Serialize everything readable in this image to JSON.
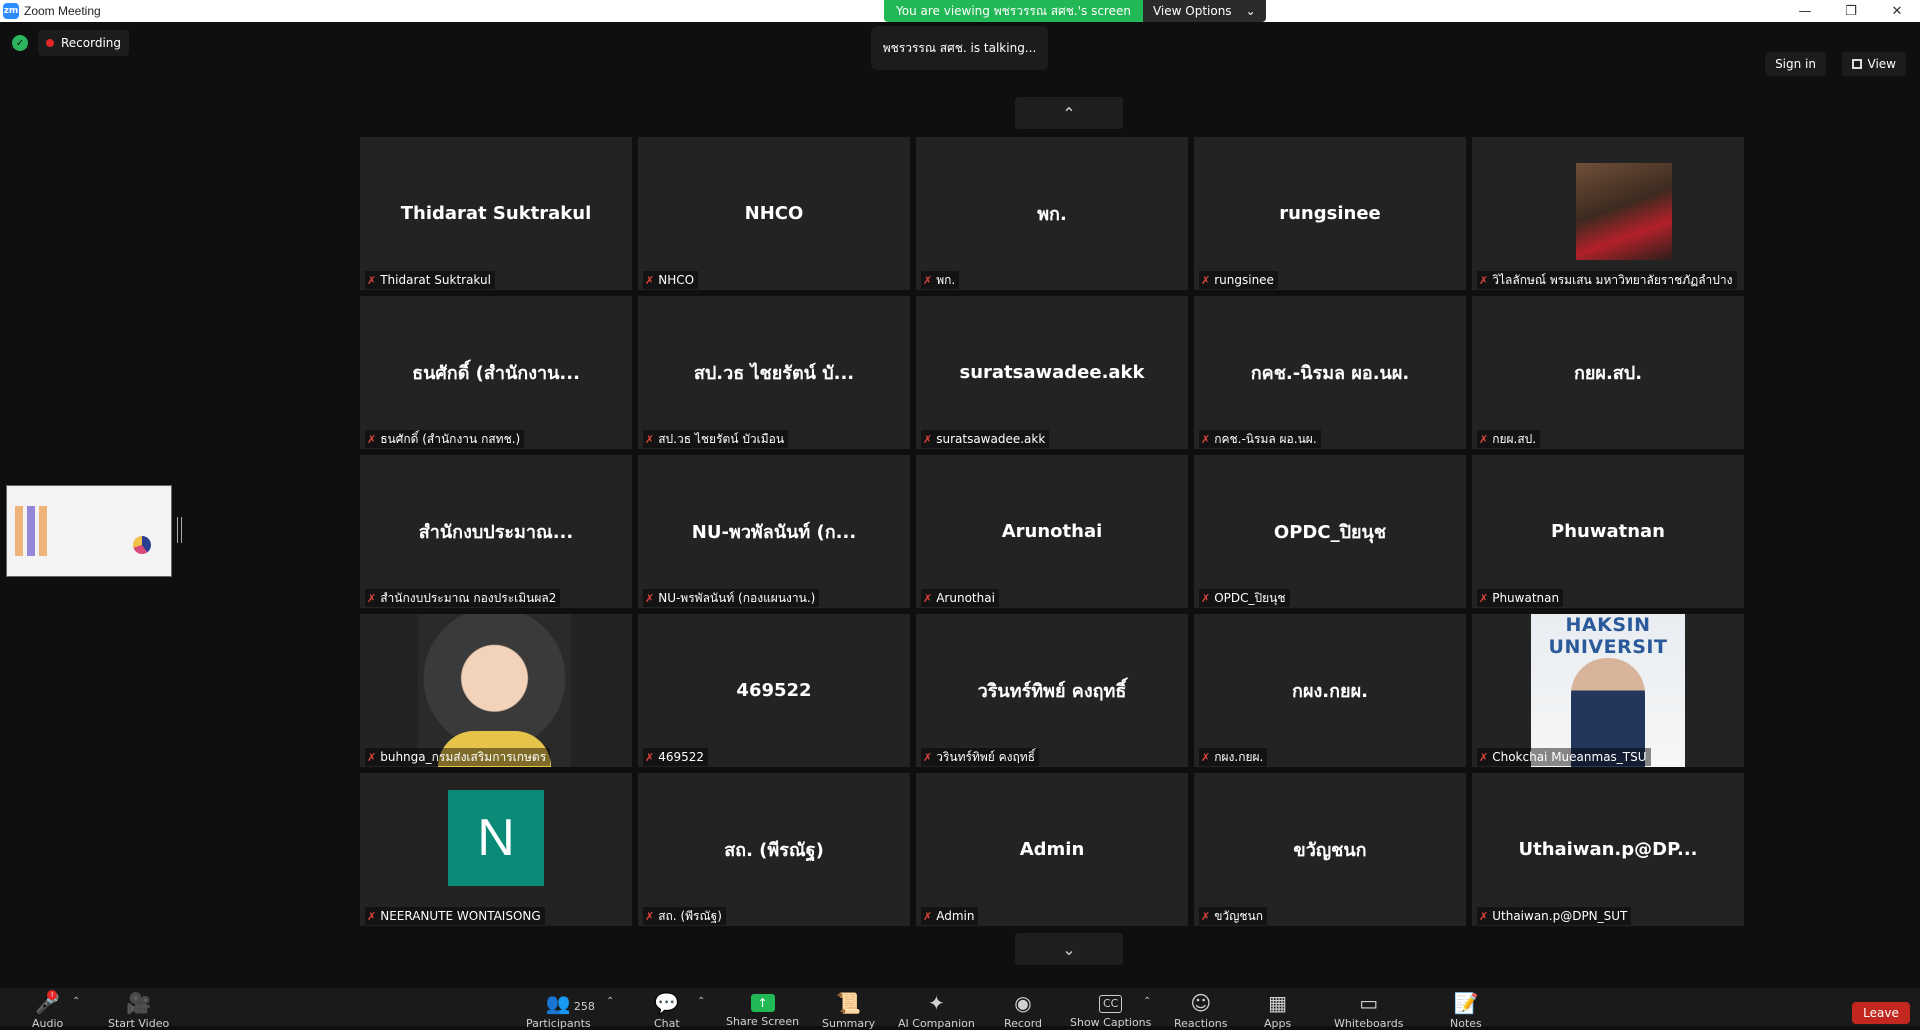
{
  "window": {
    "title": "Zoom Meeting",
    "logo": "zm"
  },
  "share_banner": {
    "text": "You are viewing พชรวรรณ สศช.'s screen",
    "view_options": "View Options"
  },
  "status": {
    "recording": "Recording",
    "talking": "พชรวรรณ สศช. is talking..."
  },
  "header": {
    "sign_in": "Sign in",
    "view": "View"
  },
  "tiles": [
    {
      "center": "Thidarat Suktrakul",
      "label": "Thidarat Suktrakul"
    },
    {
      "center": "NHCO",
      "label": "NHCO"
    },
    {
      "center": "พก.",
      "label": "พก."
    },
    {
      "center": "rungsinee",
      "label": "rungsinee"
    },
    {
      "center": "",
      "label": "วิไลลักษณ์ พรมเสน มหาวิทยาลัยราชภัฏลำปาง"
    },
    {
      "center": "ธนศักดิ์ (สำนักงาน...",
      "label": "ธนศักดิ์ (สำนักงาน กสทช.)"
    },
    {
      "center": "สป.วธ ไชยรัตน์ บั...",
      "label": "สป.วธ ไชยรัตน์ บัวเมือน"
    },
    {
      "center": "suratsawadee.akk",
      "label": "suratsawadee.akk"
    },
    {
      "center": "กคช.-นิรมล ผอ.นผ.",
      "label": "กคช.-นิรมล ผอ.นผ."
    },
    {
      "center": "กยผ.สป.",
      "label": "กยผ.สป."
    },
    {
      "center": "สำนักงบประมาณ...",
      "label": "สำนักงบประมาณ กองประเมินผล2"
    },
    {
      "center": "NU-พวพัลนันท์ (ก...",
      "label": "NU-พรพัลนันท์ (กองแผนงาน.)"
    },
    {
      "center": "Arunothai",
      "label": "Arunothai"
    },
    {
      "center": "OPDC_ปิยนุช",
      "label": "OPDC_ปิยนุช"
    },
    {
      "center": "Phuwatnan",
      "label": "Phuwatnan"
    },
    {
      "center": "",
      "label": "buhnga_กรมส่งเสริมการเกษตร"
    },
    {
      "center": "469522",
      "label": "469522"
    },
    {
      "center": "วรินทร์ทิพย์ คงฤทธิ์",
      "label": "วรินทร์ทิพย์ คงฤทธิ์"
    },
    {
      "center": "กผง.กยผ.",
      "label": "กผง.กยผ."
    },
    {
      "center": "",
      "label": "Chokchai Mueanmas_TSU",
      "photo_text": "HAKSIN UNIVERSIT"
    },
    {
      "center": "",
      "label": "NEERANUTE WONTAISONG",
      "avatar_letter": "N"
    },
    {
      "center": "สถ. (พีรณัฐ)",
      "label": "สถ. (พีรณัฐ)"
    },
    {
      "center": "Admin",
      "label": "Admin"
    },
    {
      "center": "ขวัญชนก",
      "label": "ขวัญชนก"
    },
    {
      "center": "Uthaiwan.p@DP...",
      "label": "Uthaiwan.p@DPN_SUT"
    }
  ],
  "toolbar": {
    "audio": "Audio",
    "video": "Start Video",
    "participants": "Participants",
    "participants_count": "258",
    "chat": "Chat",
    "share": "Share Screen",
    "summary": "Summary",
    "ai": "AI Companion",
    "record": "Record",
    "captions": "Show Captions",
    "reactions": "Reactions",
    "apps": "Apps",
    "whiteboards": "Whiteboards",
    "notes": "Notes",
    "leave": "Leave",
    "captions_badge": "CC"
  },
  "colors": {
    "share_green": "#23b856",
    "leave_red": "#c2281f",
    "avatar_teal": "#0b8a77",
    "muted_red": "#e0453c"
  }
}
